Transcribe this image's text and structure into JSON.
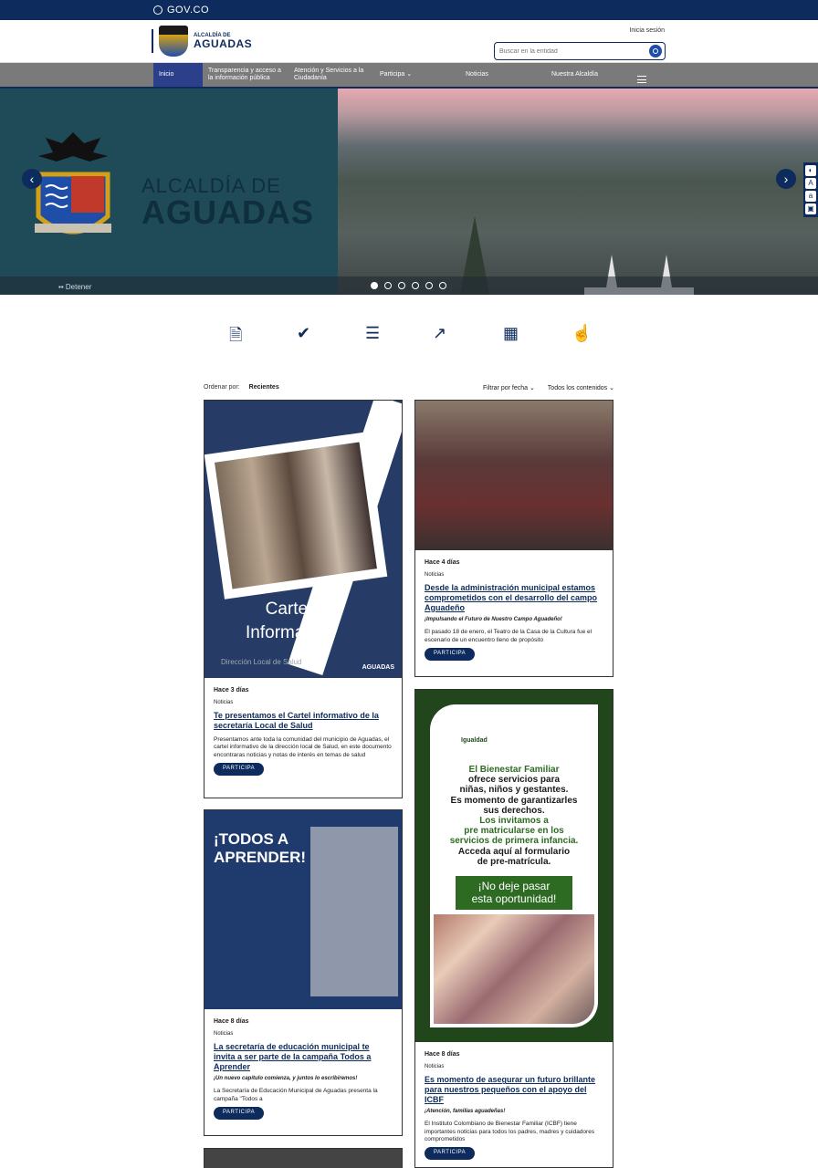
{
  "govbar": {
    "label": "GOV.CO"
  },
  "header": {
    "logo_line1": "ALCALDÍA DE",
    "logo_line2": "AGUADAS",
    "login": "Inicia sesión",
    "search_placeholder": "Buscar en la entidad"
  },
  "nav": {
    "items": [
      "Inicio",
      "Transparencia y acceso a la información pública",
      "Atención y Servicios a la Ciudadanía",
      "Participa",
      "Noticias",
      "Nuestra Alcaldía"
    ]
  },
  "hero": {
    "title_line1": "ALCALDÍA DE",
    "title_line2": "AGUADAS",
    "stop_label": "Detener",
    "slide_count": 6,
    "active_slide": 1
  },
  "colors": {
    "primary": "#0d2b5c",
    "accent": "#1f4ea8",
    "green": "#21461b"
  },
  "quick_icons": [
    "document-icon",
    "check-icon",
    "list-icon",
    "chart-icon",
    "calendar-icon",
    "hand-icon"
  ],
  "sort": {
    "label": "Ordenar por:",
    "value": "Recientes",
    "filter_date": "Filtrar por fecha",
    "filter_content": "Todos los contenidos"
  },
  "cards": [
    {
      "media_title_1": "Cartel",
      "media_title_2": "Informativo",
      "media_sub": "Dirección Local de Salud",
      "media_logo": "AGUADAS",
      "when": "Hace 3 días",
      "category": "Noticias",
      "title": "Te presentamos el Cartel informativo de la secretaría Local de Salud",
      "description": "Presentamos ante toda la comunidad del municipio de Aguadas, el cartel informativo de la dirección local de Salud, en este documento encontraras noticias y notas de interés en temas de salud",
      "button": "PARTICIPA"
    },
    {
      "when": "Hace 4 días",
      "category": "Noticias",
      "title": "Desde la administración municipal estamos comprometidos con el desarrollo del campo Aguadeño",
      "subtitle": "¡Impulsando el Futuro de Nuestro Campo Aguadeño!",
      "description": "El pasado 18 de enero, el Teatro de la Casa de la Cultura fue el escenario de un encuentro lleno de propósito",
      "button": "PARTICIPA"
    },
    {
      "media_title_1": "¡TODOS A",
      "media_title_2": "APRENDER!",
      "when": "Hace 8 días",
      "category": "Noticias",
      "title": "La secretaría de educación municipal te invita a ser parte de la campaña Todos a Aprender",
      "subtitle": "¡Un nuevo capítulo comienza, y juntos lo escribiremos!",
      "description": "La Secretaría de Educación Municipal de Aguadas presenta la campaña \"Todos a",
      "button": "PARTICIPA"
    },
    {
      "media_logo_1": "Igualdad",
      "media_line1": "El Bienestar Familiar",
      "media_line2": "ofrece servicios para",
      "media_line3": "niñas, niños y gestantes.",
      "media_line4": "Es momento de garantizarles",
      "media_line5": "sus derechos.",
      "media_line6": "Los invitamos a",
      "media_line7": "pre matricularse en los",
      "media_line8": "servicios de primera infancia.",
      "media_line9": "Acceda aquí al formulario",
      "media_line10": "de pre-matrícula.",
      "media_cta1": "¡No deje pasar",
      "media_cta2": "esta oportunidad!",
      "when": "Hace 8 días",
      "category": "Noticias",
      "title": "Es momento de asegurar un futuro brillante para nuestros pequeños con el apoyo del ICBF",
      "subtitle": "¡Atención, familias aguadeñas!",
      "description": "El Instituto Colombiano de Bienestar Familiar (ICBF) tiene importantes noticias para todos los padres, madres y cuidadores comprometidos",
      "button": "PARTICIPA"
    }
  ]
}
